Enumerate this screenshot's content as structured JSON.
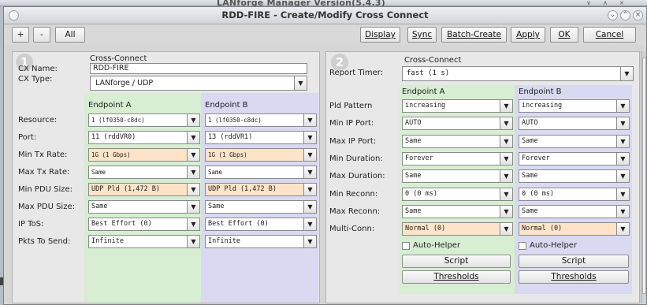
{
  "background_window": {
    "title": "LANforge Manager   Version(5.4.3)"
  },
  "window": {
    "title": "RDD-FIRE - Create/Modify Cross Connect"
  },
  "toolbar": {
    "plus": "+",
    "minus": "-",
    "all": "All",
    "display": "Display",
    "sync": "Sync",
    "batch_create": "Batch-Create",
    "apply": "Apply",
    "ok": "OK",
    "cancel": "Cancel"
  },
  "left_panel": {
    "number": "1",
    "header": "Cross-Connect",
    "cx_name_label": "CX Name:",
    "cx_name_value": "RDD-FIRE",
    "cx_type_label": "CX Type:",
    "cx_type_value": "LANforge / UDP",
    "endpoint_a": "Endpoint A",
    "endpoint_b": "Endpoint B",
    "rows": [
      {
        "label": "Resource:",
        "a": "1 (lf0350-c8dc)",
        "b": "1 (lf0350-c8dc)",
        "highlight": false
      },
      {
        "label": "Port:",
        "a": "11 (rddVR0)",
        "b": "13 (rddVR1)",
        "highlight": false
      },
      {
        "label": "Min Tx Rate:",
        "a": "1G     (1 Gbps)",
        "b": "1G     (1 Gbps)",
        "highlight": true
      },
      {
        "label": "Max Tx Rate:",
        "a": "Same",
        "b": "Same",
        "highlight": false
      },
      {
        "label": "Min PDU Size:",
        "a": "UDP Pld   (1,472 B)",
        "b": "UDP Pld   (1,472 B)",
        "highlight": true
      },
      {
        "label": "Max PDU Size:",
        "a": "Same",
        "b": "Same",
        "highlight": false
      },
      {
        "label": "IP ToS:",
        "a": "Best Effort    (0)",
        "b": "Best Effort    (0)",
        "highlight": false
      },
      {
        "label": "Pkts To Send:",
        "a": "Infinite",
        "b": "Infinite",
        "highlight": false
      }
    ]
  },
  "right_panel": {
    "number": "2",
    "header": "Cross-Connect",
    "report_timer_label": "Report Timer:",
    "report_timer_value": "fast      (1 s)",
    "endpoint_a": "Endpoint A",
    "endpoint_b": "Endpoint B",
    "rows": [
      {
        "label": "Pld Pattern",
        "a": "increasing",
        "b": "increasing",
        "highlight": false
      },
      {
        "label": "Min IP Port:",
        "a": "AUTO",
        "b": "AUTO",
        "highlight": false
      },
      {
        "label": "Max IP Port:",
        "a": "Same",
        "b": "Same",
        "highlight": false
      },
      {
        "label": "Min Duration:",
        "a": "Forever",
        "b": "Forever",
        "highlight": false
      },
      {
        "label": "Max Duration:",
        "a": "Same",
        "b": "Same",
        "highlight": false
      },
      {
        "label": "Min Reconn:",
        "a": "0      (0 ms)",
        "b": "0      (0 ms)",
        "highlight": false
      },
      {
        "label": "Max Reconn:",
        "a": "Same",
        "b": "Same",
        "highlight": false
      },
      {
        "label": "Multi-Conn:",
        "a": "Normal (0)",
        "b": "Normal (0)",
        "highlight": true
      }
    ],
    "auto_helper": "Auto-Helper",
    "script": "Script",
    "thresholds": "Thresholds"
  },
  "colors": {
    "endpoint_a_bg": "#d7eed3",
    "endpoint_b_bg": "#d9d9f2",
    "highlight_field": "#fde3c8"
  }
}
